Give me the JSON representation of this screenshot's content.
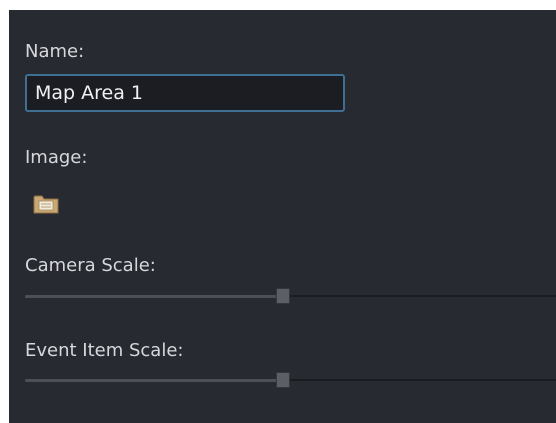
{
  "fields": {
    "name_label": "Name:",
    "name_value": "Map Area 1",
    "image_label": "Image:",
    "image_button_icon": "folder-icon",
    "camera_scale_label": "Camera Scale:",
    "camera_scale_fraction": 0.485,
    "event_item_scale_label": "Event Item Scale:",
    "event_item_scale_fraction": 0.485
  },
  "colors": {
    "panel_background": "#272a31",
    "input_border_focus": "#3f6f93",
    "folder_icon": "#c9a874"
  }
}
